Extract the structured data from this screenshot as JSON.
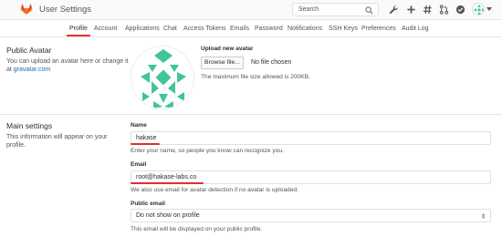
{
  "header": {
    "title": "User Settings",
    "search_placeholder": "Search"
  },
  "tabs": [
    "Profile",
    "Account",
    "Applications",
    "Chat",
    "Access Tokens",
    "Emails",
    "Password",
    "Notifications",
    "SSH Keys",
    "Preferences",
    "Audit Log"
  ],
  "public_avatar": {
    "title": "Public Avatar",
    "desc_line1": "You can upload an avatar here or change it",
    "desc_at": "at",
    "desc_link": "gravatar.com",
    "upload_label": "Upload new avatar",
    "browse_button": "Browse file...",
    "file_chosen": "No file chosen",
    "max_size": "The maximum file size allowed is 200KB."
  },
  "main_settings": {
    "title": "Main settings",
    "desc_line1": "This information will appear on your",
    "desc_line2": "profile.",
    "name_label": "Name",
    "name_value": "hakase",
    "name_hint": "Enter your name, so people you know can recognize you.",
    "email_label": "Email",
    "email_value": "root@hakase-labs.co",
    "email_hint": "We also use email for avatar detection if no avatar is uploaded.",
    "public_email_label": "Public email",
    "public_email_value": "Do not show on profile",
    "public_email_hint": "This email will be displayed on your public profile."
  },
  "colors": {
    "accent": "#db3b21",
    "avatar_green": "#3fc59a",
    "annotation_red": "#e02f2f",
    "link": "#1b69b6"
  }
}
